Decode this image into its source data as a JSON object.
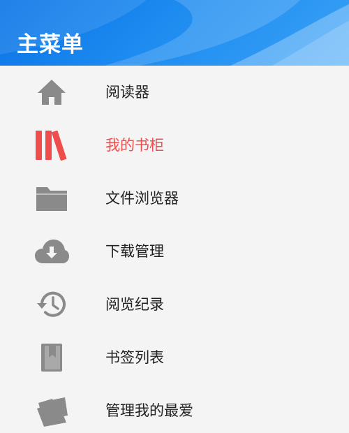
{
  "header": {
    "title": "主菜单"
  },
  "menu": {
    "items": [
      {
        "label": "阅读器",
        "icon": "home-icon",
        "active": false
      },
      {
        "label": "我的书柜",
        "icon": "bookshelf-icon",
        "active": true
      },
      {
        "label": "文件浏览器",
        "icon": "folder-icon",
        "active": false
      },
      {
        "label": "下载管理",
        "icon": "cloud-download-icon",
        "active": false
      },
      {
        "label": "阅览纪录",
        "icon": "history-icon",
        "active": false
      },
      {
        "label": "书签列表",
        "icon": "bookmark-book-icon",
        "active": false
      },
      {
        "label": "管理我的最爱",
        "icon": "favorites-icon",
        "active": false
      }
    ]
  },
  "colors": {
    "accent": "#ef4c4c",
    "header_blue": "#1d8bf0",
    "icon_gray": "#8a8a8a",
    "text": "#222222",
    "background": "#f4f4f4"
  }
}
